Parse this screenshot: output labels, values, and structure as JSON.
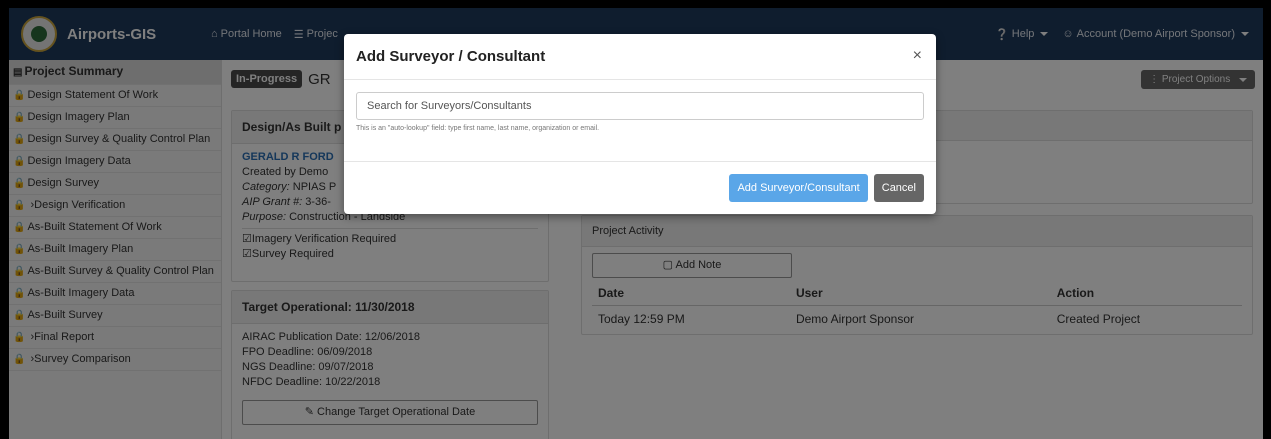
{
  "navbar": {
    "brand": "Airports-GIS",
    "portal_home": "Portal Home",
    "projects": "Projec",
    "help": "Help",
    "account": "Account (Demo Airport Sponsor)"
  },
  "sidebar": {
    "items": [
      {
        "label": "Project Summary",
        "locked": false,
        "head": true
      },
      {
        "label": "Design Statement Of Work",
        "locked": true
      },
      {
        "label": "Design Imagery Plan",
        "locked": true
      },
      {
        "label": "Design Survey & Quality Control Plan",
        "locked": true
      },
      {
        "label": "Design Imagery Data",
        "locked": true
      },
      {
        "label": "Design Survey",
        "locked": true
      },
      {
        "label": "›Design Verification",
        "locked": true
      },
      {
        "label": "As-Built Statement Of Work",
        "locked": true
      },
      {
        "label": "As-Built Imagery Plan",
        "locked": true
      },
      {
        "label": "As-Built Survey & Quality Control Plan",
        "locked": true
      },
      {
        "label": "As-Built Imagery Data",
        "locked": true
      },
      {
        "label": "As-Built Survey",
        "locked": true
      },
      {
        "label": "›Final Report",
        "locked": true
      },
      {
        "label": "›Survey Comparison",
        "locked": true
      }
    ]
  },
  "main": {
    "status_badge": "In-Progress",
    "project_title": "GR",
    "project_options": "Project Options",
    "design_panel": {
      "header": "Design/As Built p",
      "link": "GERALD R FORD",
      "created_by": "Created by Demo",
      "category_label": "Category:",
      "category_value": "NPIAS P",
      "grant_label": "AIP Grant #:",
      "grant_value": "3-36-",
      "purpose_label": "Purpose:",
      "purpose_value": "Construction - Landside",
      "check1": "Imagery Verification Required",
      "check2": "Survey Required"
    },
    "target_panel": {
      "header": "Target Operational: 11/30/2018",
      "airac": "AIRAC Publication Date: 12/06/2018",
      "fpo": "FPO Deadline: 06/09/2018",
      "ngs": "NGS Deadline: 09/07/2018",
      "nfdc": "NFDC Deadline: 10/22/2018",
      "change_button": "Change Target Operational Date"
    },
    "activity_panel": {
      "header": "Project Activity",
      "add_note": "Add Note",
      "columns": [
        "Date",
        "User",
        "Action"
      ],
      "rows": [
        {
          "date": "Today 12:59 PM",
          "user": "Demo Airport Sponsor",
          "action": "Created Project"
        }
      ]
    }
  },
  "modal": {
    "title": "Add Surveyor / Consultant",
    "close": "×",
    "search_placeholder": "Search for Surveyors/Consultants",
    "help_text": "This is an \"auto-lookup\" field: type first name, last name, organization or email.",
    "add_button": "Add Surveyor/Consultant",
    "cancel_button": "Cancel"
  }
}
